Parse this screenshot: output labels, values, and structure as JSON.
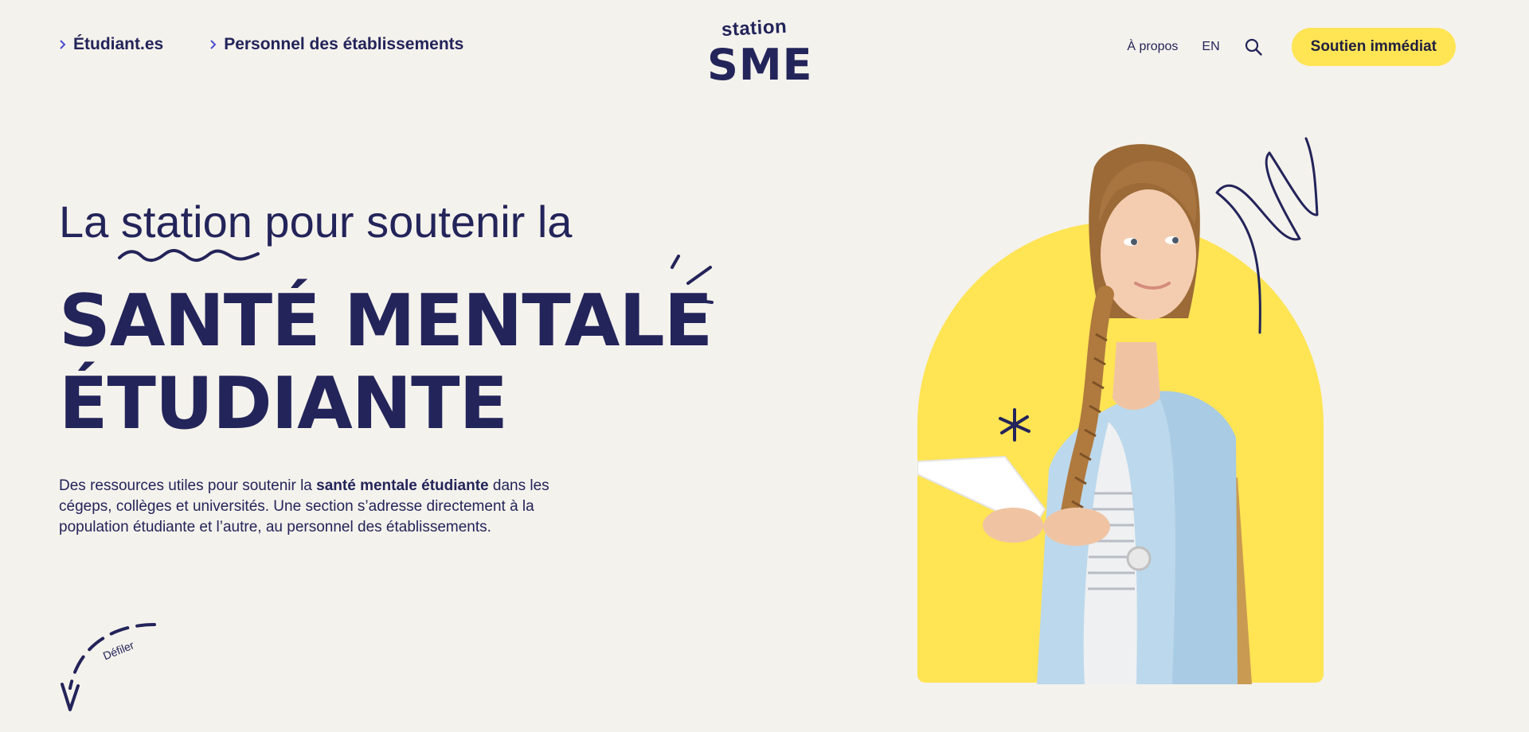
{
  "header": {
    "nav_left": [
      {
        "label": "Étudiant.es"
      },
      {
        "label": "Personnel des établissements"
      }
    ],
    "logo": {
      "top": "station",
      "bottom": "SME"
    },
    "nav_right": {
      "about": "À propos",
      "language": "EN",
      "search_icon": "search-icon",
      "cta": "Soutien immédiat"
    }
  },
  "hero": {
    "line1_pre": "La",
    "line1_station": "station",
    "line1_post": "pour soutenir la",
    "title_line1": "SANTÉ MENTALE",
    "title_line2": "ÉTUDIANTE",
    "desc_pre": "Des ressources utiles pour soutenir la ",
    "desc_bold": "santé mentale étudiante",
    "desc_post": " dans les cégeps, collèges et universités. Une section s’adresse directement à la population étudiante et l’autre, au personnel des établissements."
  },
  "scroll": {
    "label": "Défiler"
  },
  "colors": {
    "background": "#f4f2ec",
    "navy": "#23245a",
    "yellow": "#ffe454"
  }
}
